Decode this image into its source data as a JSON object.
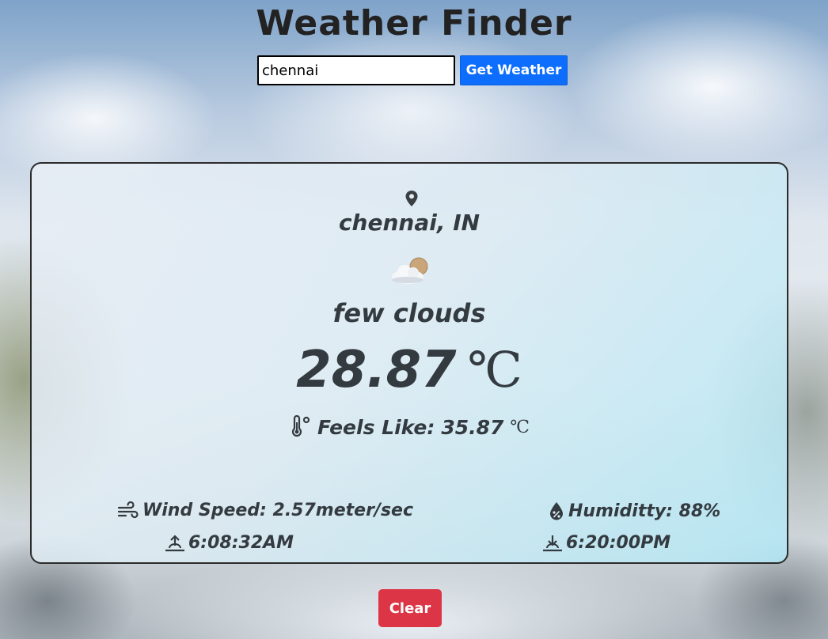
{
  "app": {
    "title": "Weather Finder"
  },
  "search": {
    "value": "chennai",
    "button_label": "Get Weather"
  },
  "weather": {
    "location": "chennai, IN",
    "condition_icon": "few-clouds-icon",
    "description": "few clouds",
    "temperature": "28.87",
    "temperature_unit": "℃",
    "feels_like_label": "Feels Like:",
    "feels_like_value": "35.87",
    "feels_like_unit": "℃",
    "wind_speed": "Wind Speed: 2.57meter/sec",
    "humidity": "Humiditty: 88%",
    "sunrise": "6:08:32AM",
    "sunset": "6:20:00PM"
  },
  "actions": {
    "clear_label": "Clear"
  },
  "colors": {
    "primary_button": "#0d6efd",
    "danger_button": "#dc3545",
    "text": "#333a40"
  }
}
